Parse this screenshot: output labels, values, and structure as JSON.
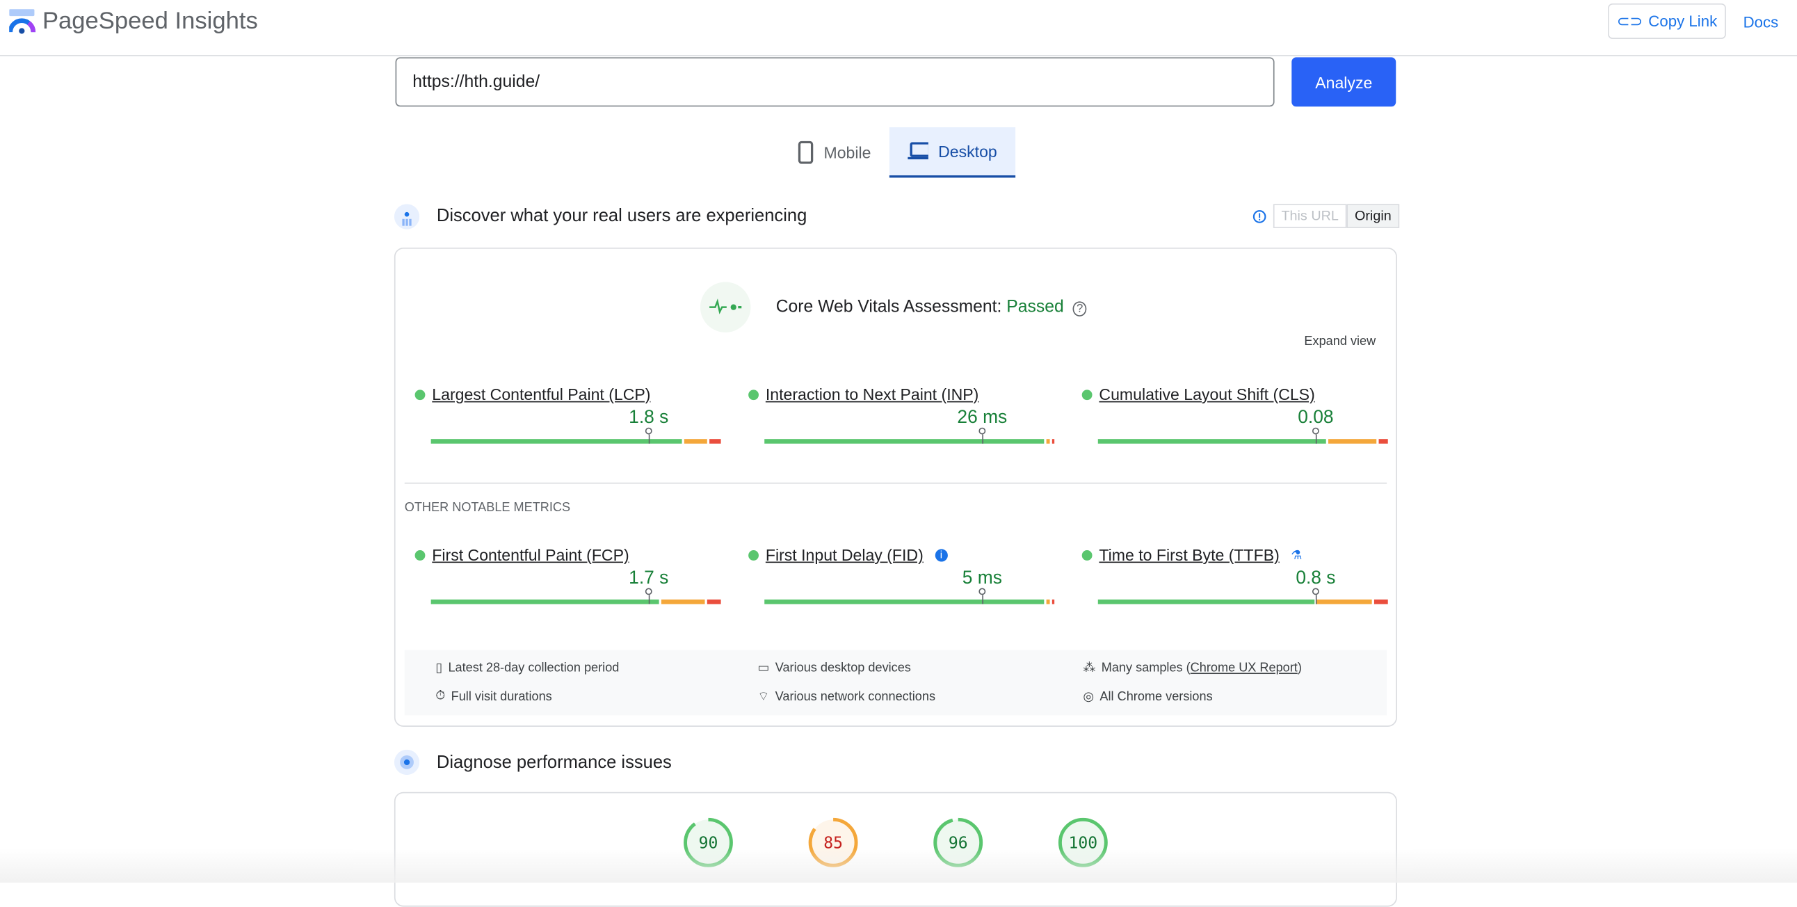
{
  "header": {
    "app_title": "PageSpeed Insights",
    "copy_link": "Copy Link",
    "docs": "Docs"
  },
  "search": {
    "url": "https://hth.guide/",
    "analyze": "Analyze"
  },
  "tabs": [
    {
      "label": "Mobile",
      "active": false
    },
    {
      "label": "Desktop",
      "active": true
    }
  ],
  "field": {
    "title": "Discover what your real users are experiencing",
    "toggle": [
      "This URL",
      "Origin"
    ],
    "selected": "Origin",
    "assessment_label": "Core Web Vitals Assessment:",
    "assessment_status": "Passed",
    "expand": "Expand view",
    "other_label": "OTHER NOTABLE METRICS",
    "core_metrics": [
      {
        "name": "Largest Contentful Paint (LCP)",
        "value": "1.8 s",
        "distribution": [
          87,
          8,
          4
        ]
      },
      {
        "name": "Interaction to Next Paint (INP)",
        "value": "26 ms",
        "distribution": [
          98,
          1,
          1
        ]
      },
      {
        "name": "Cumulative Layout Shift (CLS)",
        "value": "0.08",
        "distribution": [
          79,
          17,
          3
        ]
      }
    ],
    "other_metrics": [
      {
        "name": "First Contentful Paint (FCP)",
        "value": "1.7 s",
        "distribution": [
          80,
          15,
          5
        ],
        "icon": ""
      },
      {
        "name": "First Input Delay (FID)",
        "value": "5 ms",
        "distribution": [
          98,
          1,
          1
        ],
        "icon": "info-icon"
      },
      {
        "name": "Time to First Byte (TTFB)",
        "value": "0.8 s",
        "distribution": [
          76,
          19,
          5
        ],
        "icon": "flask-icon"
      }
    ],
    "footer": {
      "period": "Latest 28-day collection period",
      "devices": "Various desktop devices",
      "samples_prefix": "Many samples (",
      "samples_link": "Chrome UX Report",
      "samples_suffix": ")",
      "durations": "Full visit durations",
      "network": "Various network connections",
      "chrome": "All Chrome versions"
    }
  },
  "diagnose": {
    "title": "Diagnose performance issues",
    "scores": [
      90,
      85,
      96,
      100
    ]
  },
  "colors": {
    "good": "#5ac66e",
    "ni": "#f4a73a",
    "poor": "#ea4e3d",
    "accent": "#2962f6"
  }
}
